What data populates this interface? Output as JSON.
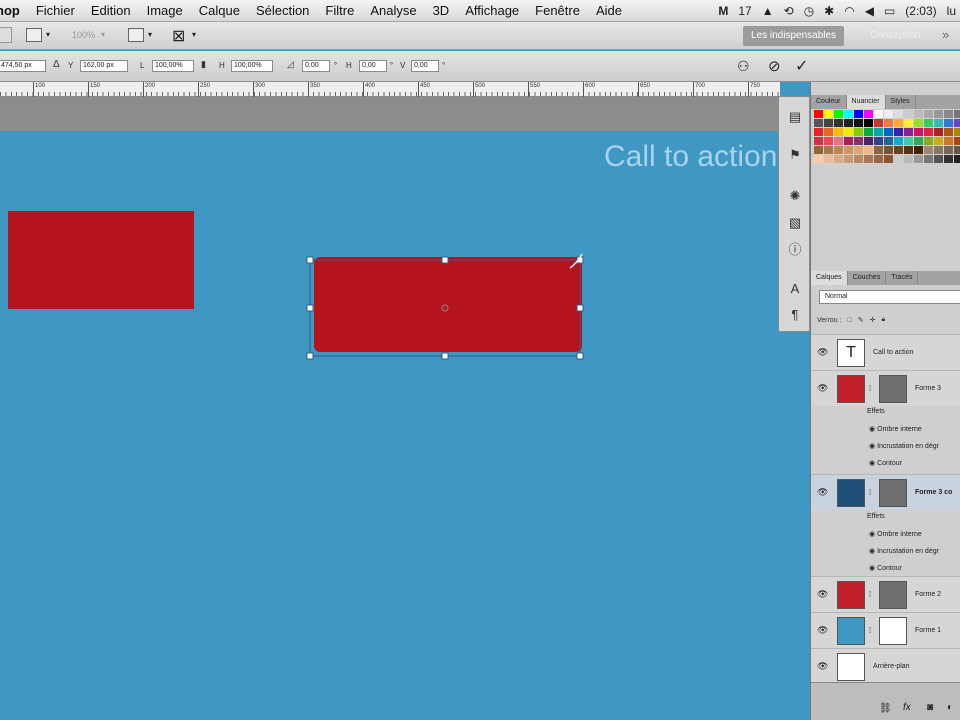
{
  "menubar": {
    "app": "hop",
    "items": [
      "Fichier",
      "Edition",
      "Image",
      "Calque",
      "Sélection",
      "Filtre",
      "Analyse",
      "3D",
      "Affichage",
      "Fenêtre",
      "Aide"
    ],
    "status": {
      "adobe_count": "17",
      "battery": "(2:03)",
      "user": "lu"
    }
  },
  "appbar": {
    "zoom": "100%",
    "workspace_active": "Les indispensables",
    "workspace_other": "Conception",
    "more": "»"
  },
  "options": {
    "x": "474,50 px",
    "y_label": "Y",
    "y": "162,00 px",
    "l_label": "L",
    "l": "100,00%",
    "h_label": "H",
    "h": "100,00%",
    "angle": "0,00",
    "hskew": "0,00",
    "v_label": "V",
    "vskew": "0,00"
  },
  "ruler": {
    "labels": [
      "100",
      "150",
      "200",
      "250",
      "300",
      "350",
      "400",
      "450",
      "500",
      "550",
      "600",
      "650",
      "700",
      "750"
    ]
  },
  "canvas": {
    "cta_text": "Call to action",
    "shape_color": "#b5141f",
    "bg_color": "#3f97c4"
  },
  "swatches_panel": {
    "tabs": [
      "Couleur",
      "Nuancier",
      "Styles"
    ],
    "active": "Nuancier"
  },
  "layers_panel": {
    "tabs": [
      "Calques",
      "Couches",
      "Tracés"
    ],
    "active": "Calques",
    "blend_mode": "Normal",
    "lock_label": "Verrou :",
    "layers": [
      {
        "name": "Call to action",
        "kind": "text"
      },
      {
        "name": "Forme 3",
        "kind": "shape",
        "color": "#c0202a",
        "effects_label": "Effets",
        "effects": [
          "Ombre interne",
          "Incrustation en dégr",
          "Contour"
        ]
      },
      {
        "name": "Forme 3 co",
        "kind": "shape",
        "color": "#1e4f78",
        "effects_label": "Effets",
        "effects": [
          "Ombre interne",
          "Incrustation en dégr",
          "Contour"
        ]
      },
      {
        "name": "Forme 2",
        "kind": "shape",
        "color": "#c0202a"
      },
      {
        "name": "Forme 1",
        "kind": "shape",
        "color": "#3f97c4"
      },
      {
        "name": "Arrière-plan",
        "kind": "background"
      }
    ]
  }
}
